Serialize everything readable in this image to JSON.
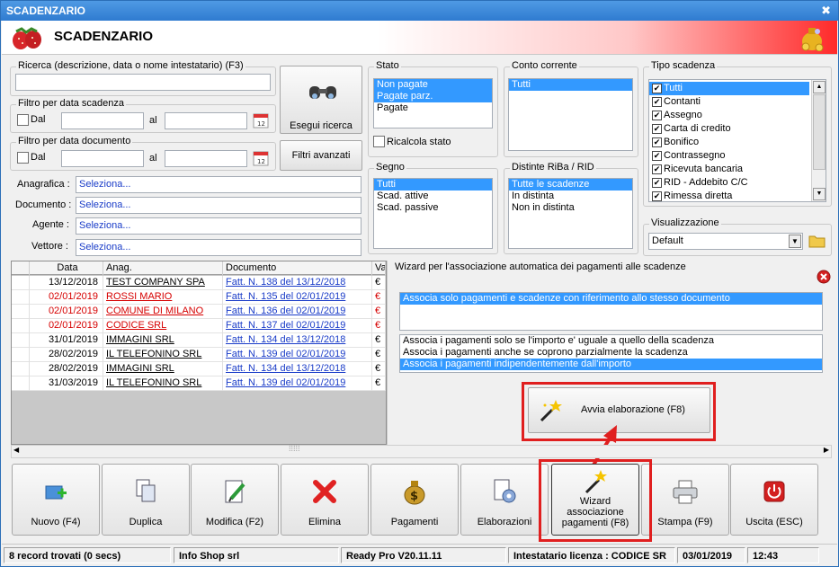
{
  "window": {
    "title": "SCADENZARIO",
    "header_title": "SCADENZARIO"
  },
  "search": {
    "label": "Ricerca (descrizione, data o nome intestatario) (F3)",
    "value": "",
    "filter_scadenza_label": "Filtro per data scadenza",
    "filter_documento_label": "Filtro per data documento",
    "dal": "Dal",
    "al": "al",
    "esegui_label": "Esegui ricerca",
    "filtri_label": "Filtri avanzati"
  },
  "fields": {
    "anagrafica_label": "Anagrafica :",
    "documento_label": "Documento :",
    "agente_label": "Agente :",
    "vettore_label": "Vettore :",
    "placeholder": "Seleziona..."
  },
  "stato": {
    "label": "Stato",
    "items": [
      "Non pagate",
      "Pagate parz.",
      "Pagate"
    ],
    "ricalcola_label": "Ricalcola stato"
  },
  "conto": {
    "label": "Conto corrente",
    "items": [
      "Tutti"
    ]
  },
  "tipo": {
    "label": "Tipo scadenza",
    "items": [
      "Tutti",
      "Contanti",
      "Assegno",
      "Carta di credito",
      "Bonifico",
      "Contrassegno",
      "Ricevuta bancaria",
      "RID - Addebito C/C",
      "Rimessa diretta"
    ]
  },
  "segno": {
    "label": "Segno",
    "items": [
      "Tutti",
      "Scad. attive",
      "Scad. passive"
    ]
  },
  "distinte": {
    "label": "Distinte RiBa / RID",
    "items": [
      "Tutte le scadenze",
      "In distinta",
      "Non in distinta"
    ]
  },
  "visualizzazione": {
    "label": "Visualizzazione",
    "value": "Default"
  },
  "grid": {
    "headers": [
      "Data",
      "Anag.",
      "Documento",
      "Val"
    ],
    "rows": [
      {
        "data": "13/12/2018",
        "anag": "TEST COMPANY SPA",
        "doc": "Fatt. N. 138 del 13/12/2018",
        "val": "€",
        "red": false
      },
      {
        "data": "02/01/2019",
        "anag": "ROSSI MARIO",
        "doc": "Fatt. N. 135 del 02/01/2019",
        "val": "€",
        "red": true
      },
      {
        "data": "02/01/2019",
        "anag": "COMUNE DI MILANO",
        "doc": "Fatt. N. 136 del 02/01/2019",
        "val": "€",
        "red": true
      },
      {
        "data": "02/01/2019",
        "anag": "CODICE SRL",
        "doc": "Fatt. N. 137 del 02/01/2019",
        "val": "€",
        "red": true
      },
      {
        "data": "31/01/2019",
        "anag": "IMMAGINI SRL",
        "doc": "Fatt. N. 134 del 13/12/2018",
        "val": "€",
        "red": false
      },
      {
        "data": "28/02/2019",
        "anag": "IL TELEFONINO SRL",
        "doc": "Fatt. N. 139 del 02/01/2019",
        "val": "€",
        "red": false
      },
      {
        "data": "28/02/2019",
        "anag": "IMMAGINI SRL",
        "doc": "Fatt. N. 134 del 13/12/2018",
        "val": "€",
        "red": false
      },
      {
        "data": "31/03/2019",
        "anag": "IL TELEFONINO SRL",
        "doc": "Fatt. N. 139 del 02/01/2019",
        "val": "€",
        "red": false
      }
    ]
  },
  "wizard": {
    "title": "Wizard per l'associazione automatica dei pagamenti alle scadenze",
    "option1": "Associa solo pagamenti e scadenze con riferimento allo stesso documento",
    "options2": [
      "Associa i pagamenti solo se l'importo e' uguale a quello della scadenza",
      "Associa i pagamenti anche se coprono parzialmente la scadenza",
      "Associa i pagamenti indipendentemente dall'importo"
    ],
    "avvia_label": "Avvia elaborazione (F8)"
  },
  "toolbar": {
    "nuovo": "Nuovo (F4)",
    "duplica": "Duplica",
    "modifica": "Modifica (F2)",
    "elimina": "Elimina",
    "pagamenti": "Pagamenti",
    "elaborazioni": "Elaborazioni",
    "wizard_l1": "Wizard",
    "wizard_l2": "associazione",
    "wizard_l3": "pagamenti (F8)",
    "stampa": "Stampa (F9)",
    "uscita": "Uscita (ESC)"
  },
  "status": {
    "records": "8 record trovati (0 secs)",
    "company": "Info Shop srl",
    "version": "Ready Pro V20.11.11",
    "licenza": "Intestatario licenza : CODICE SR",
    "date": "03/01/2019",
    "time": "12:43"
  },
  "colors": {
    "accent": "#3399ff",
    "highlight": "#e01f1f",
    "link": "#1a3cc8"
  }
}
